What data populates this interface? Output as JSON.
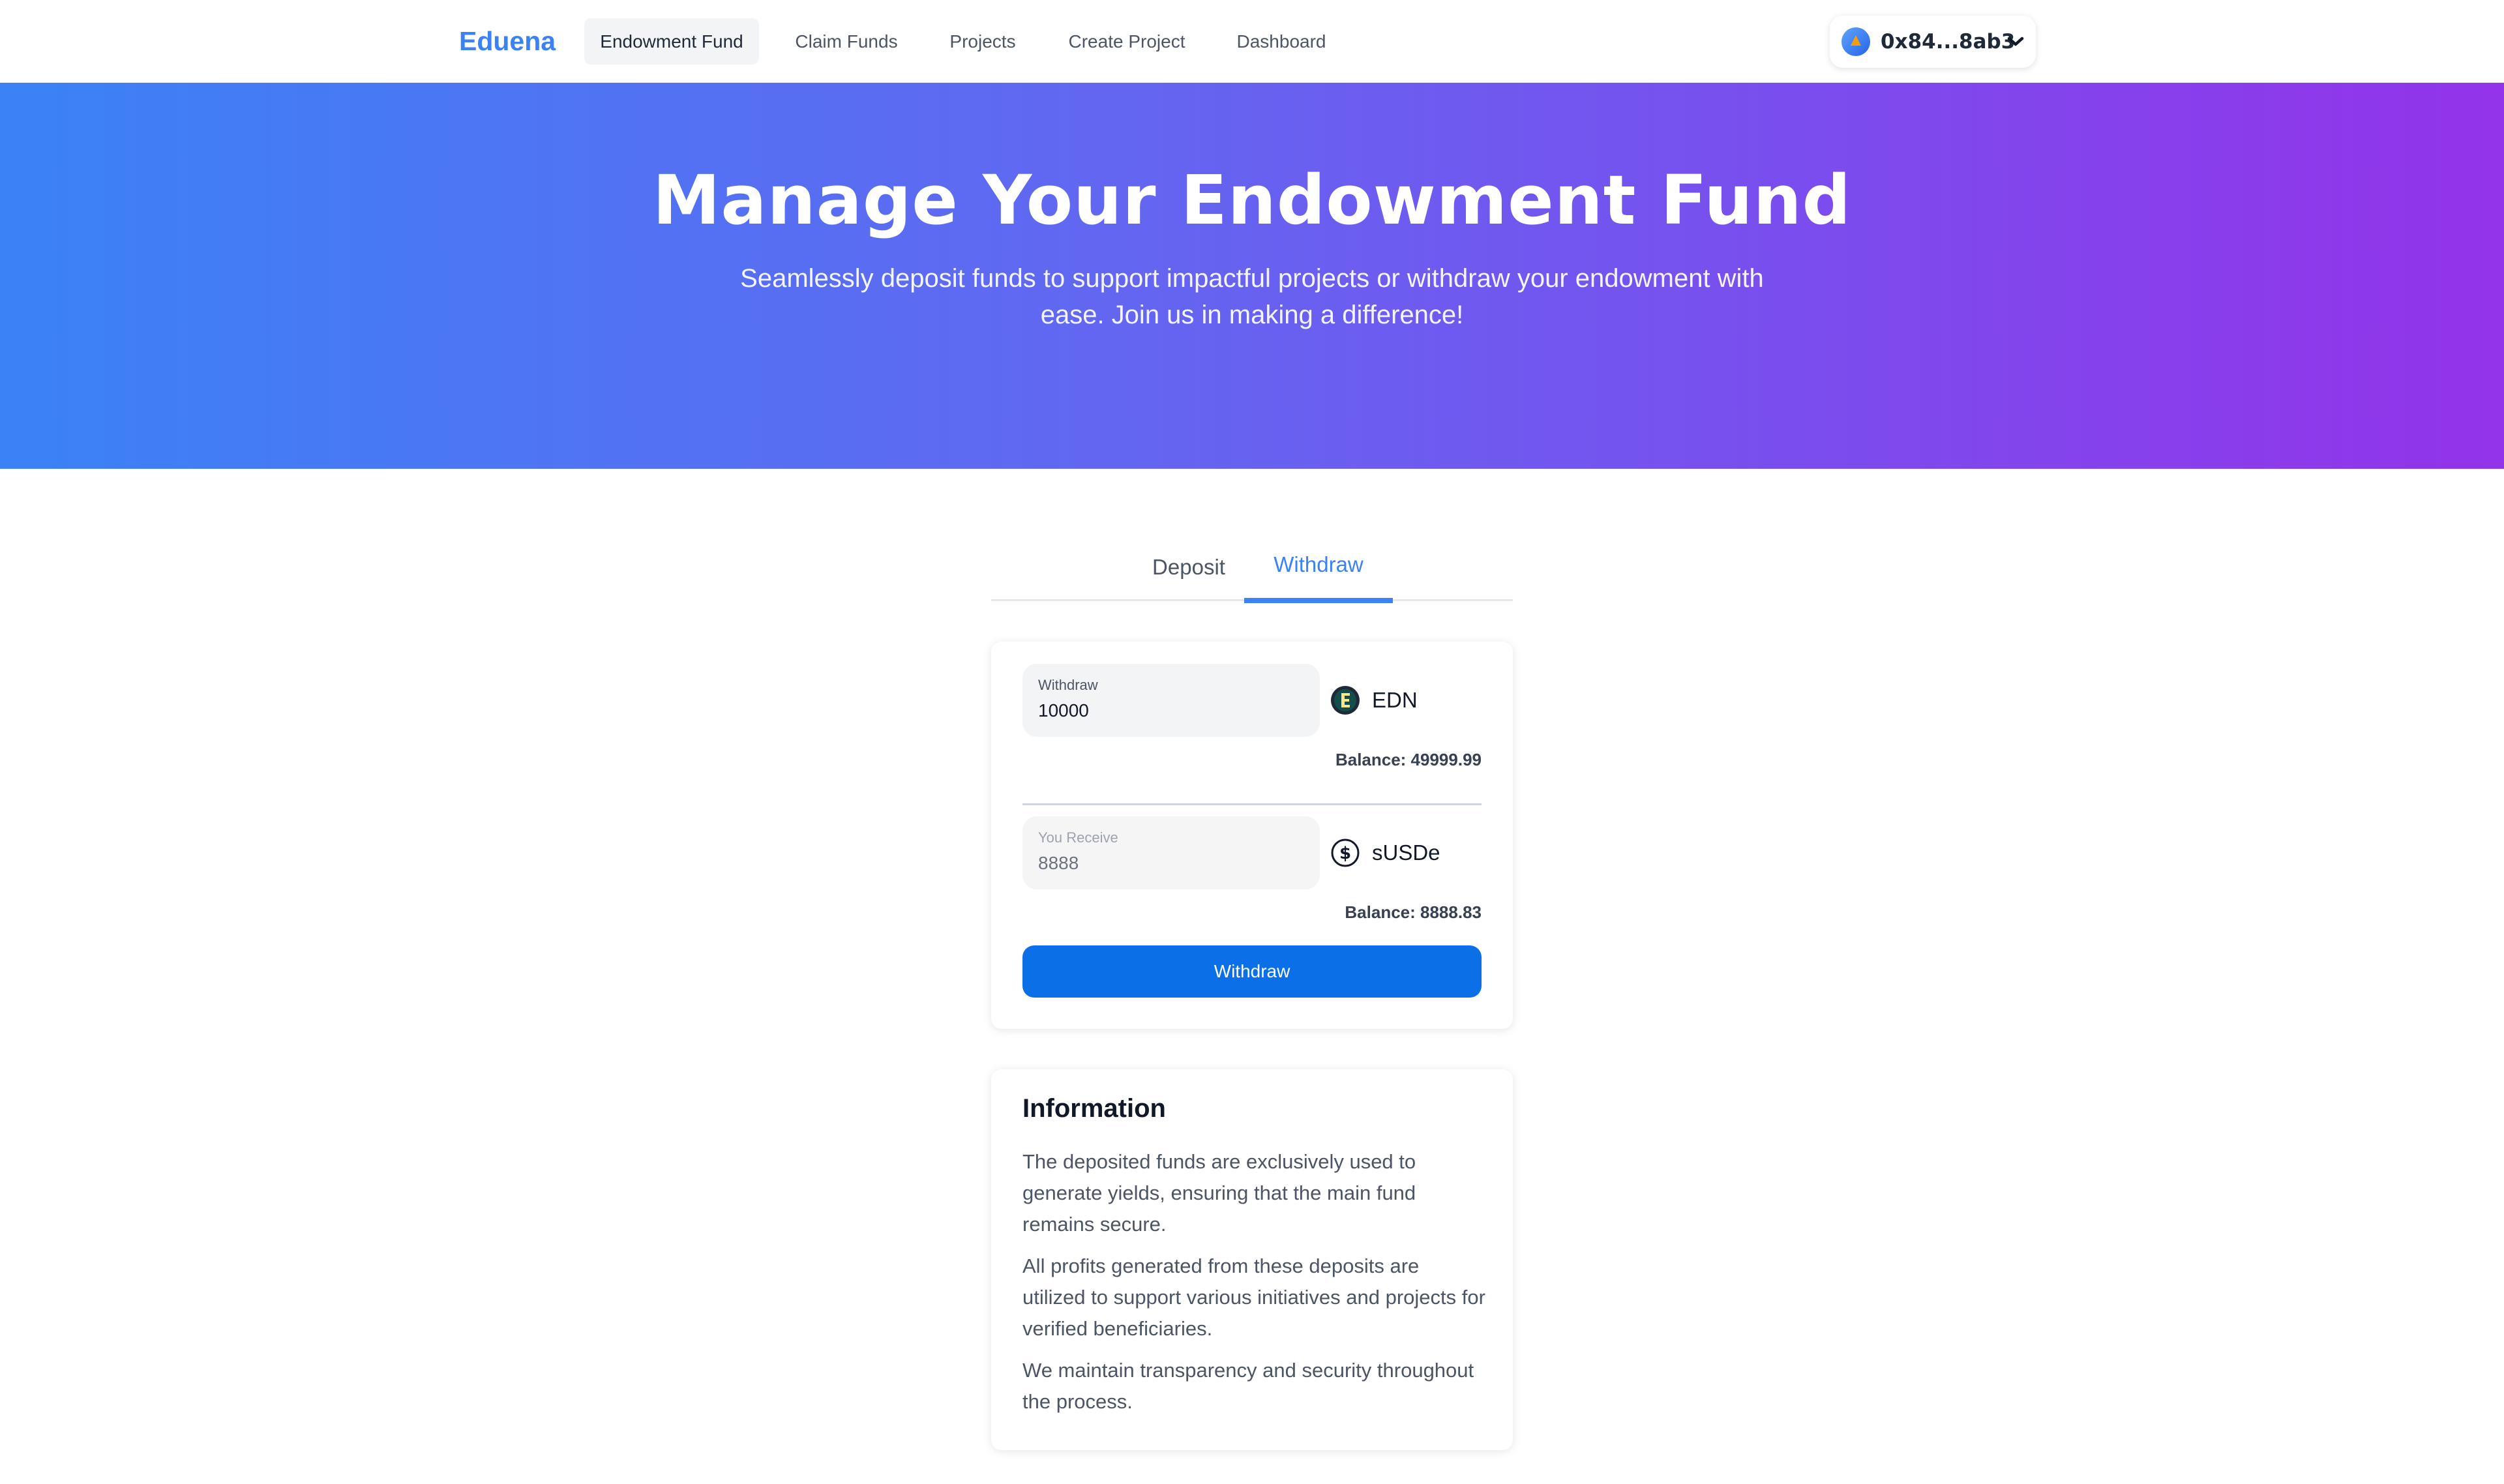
{
  "navbar": {
    "brand": "Eduena",
    "items": [
      {
        "label": "Endowment Fund",
        "active": true
      },
      {
        "label": "Claim Funds",
        "active": false
      },
      {
        "label": "Projects",
        "active": false
      },
      {
        "label": "Create Project",
        "active": false
      },
      {
        "label": "Dashboard",
        "active": false
      }
    ],
    "wallet": {
      "address": "0x84...8ab3",
      "icon": "chevron-down-icon"
    }
  },
  "hero": {
    "title": "Manage Your Endowment Fund",
    "subtitle": "Seamlessly deposit funds to support impactful projects or withdraw your endowment with ease. Join us in making a difference!"
  },
  "tabs": [
    {
      "label": "Deposit",
      "active": false
    },
    {
      "label": "Withdraw",
      "active": true
    }
  ],
  "form": {
    "withdraw_field": {
      "label": "Withdraw",
      "value": "10000"
    },
    "from_token": {
      "name": "EDN",
      "icon": "edn-token-icon",
      "balance": "Balance: 49999.99"
    },
    "receive_field": {
      "label": "You Receive",
      "value": "8888"
    },
    "to_token": {
      "name": "sUSDe",
      "icon": "dollar-token-icon",
      "balance": "Balance: 8888.83"
    },
    "submit_label": "Withdraw"
  },
  "info": {
    "title": "Information",
    "paragraphs": [
      "The deposited funds are exclusively used to generate yields, ensuring that the main fund remains secure.",
      "All profits generated from these deposits are utilized to support various initiatives and projects for verified beneficiaries.",
      "We maintain transparency and security throughout the process."
    ]
  },
  "colors": {
    "accent": "#3b82f6",
    "button": "#0b6fe8",
    "hero_start": "#3b82f6",
    "hero_end": "#9333ea"
  }
}
